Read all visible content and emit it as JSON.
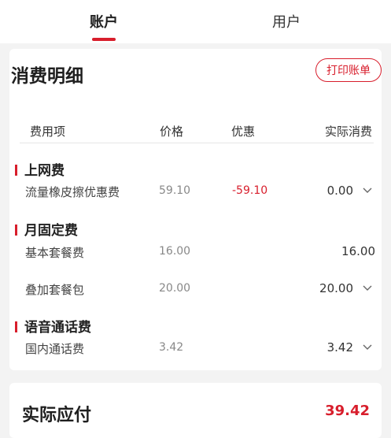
{
  "tabs": [
    {
      "label": "账户",
      "active": true
    },
    {
      "label": "用户",
      "active": false
    }
  ],
  "accent_color": "#d81e2c",
  "details": {
    "title": "消费明细",
    "print_button": "打印账单",
    "columns": [
      "费用项",
      "价格",
      "优惠",
      "实际消费"
    ],
    "groups": [
      {
        "name": "上网费",
        "items": [
          {
            "name": "流量橡皮擦优惠费",
            "price": "59.10",
            "discount": "-59.10",
            "actual": "0.00",
            "expandable": true
          }
        ]
      },
      {
        "name": "月固定费",
        "items": [
          {
            "name": "基本套餐费",
            "price": "16.00",
            "discount": "",
            "actual": "16.00",
            "expandable": false
          },
          {
            "name": "叠加套餐包",
            "price": "20.00",
            "discount": "",
            "actual": "20.00",
            "expandable": true
          }
        ]
      },
      {
        "name": "语音通话费",
        "items": [
          {
            "name": "国内通话费",
            "price": "3.42",
            "discount": "",
            "actual": "3.42",
            "expandable": true
          }
        ]
      }
    ]
  },
  "total": {
    "label": "实际应付",
    "value": "39.42"
  }
}
